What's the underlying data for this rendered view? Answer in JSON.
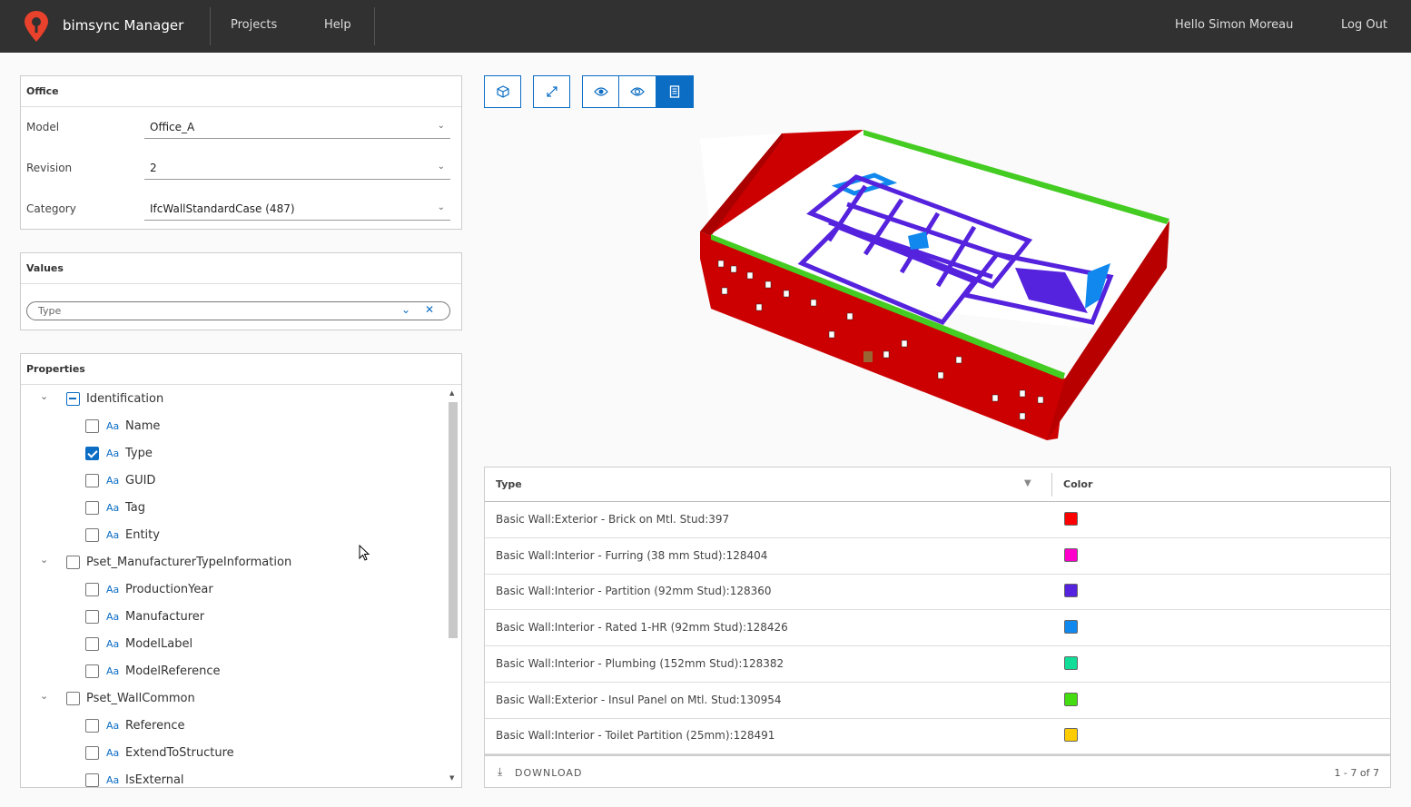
{
  "header": {
    "app_name": "bimsync Manager",
    "nav": [
      "Projects",
      "Help"
    ],
    "greeting": "Hello Simon Moreau",
    "logout": "Log Out"
  },
  "office_panel": {
    "title": "Office",
    "fields": [
      {
        "label": "Model",
        "value": "Office_A"
      },
      {
        "label": "Revision",
        "value": "2"
      },
      {
        "label": "Category",
        "value": "IfcWallStandardCase (487)"
      }
    ]
  },
  "values_panel": {
    "title": "Values",
    "selected": "Type"
  },
  "properties_panel": {
    "title": "Properties",
    "tree": [
      {
        "kind": "group",
        "label": "Identification",
        "state": "indeterminate"
      },
      {
        "kind": "item",
        "label": "Name",
        "checked": false
      },
      {
        "kind": "item",
        "label": "Type",
        "checked": true
      },
      {
        "kind": "item",
        "label": "GUID",
        "checked": false
      },
      {
        "kind": "item",
        "label": "Tag",
        "checked": false
      },
      {
        "kind": "item",
        "label": "Entity",
        "checked": false
      },
      {
        "kind": "group",
        "label": "Pset_ManufacturerTypeInformation",
        "state": "unchecked"
      },
      {
        "kind": "item",
        "label": "ProductionYear",
        "checked": false
      },
      {
        "kind": "item",
        "label": "Manufacturer",
        "checked": false
      },
      {
        "kind": "item",
        "label": "ModelLabel",
        "checked": false
      },
      {
        "kind": "item",
        "label": "ModelReference",
        "checked": false
      },
      {
        "kind": "group",
        "label": "Pset_WallCommon",
        "state": "unchecked"
      },
      {
        "kind": "item",
        "label": "Reference",
        "checked": false
      },
      {
        "kind": "item",
        "label": "ExtendToStructure",
        "checked": false
      },
      {
        "kind": "item",
        "label": "IsExternal",
        "checked": false
      }
    ],
    "type_icon_text": "Aa"
  },
  "toolbar": {
    "buttons": [
      {
        "name": "cube-view-button",
        "icon": "cube-icon"
      },
      {
        "name": "fullscreen-button",
        "icon": "expand-icon"
      },
      {
        "name": "show-button",
        "icon": "eye-filled-icon"
      },
      {
        "name": "hide-button",
        "icon": "eye-outline-icon"
      },
      {
        "name": "table-button",
        "icon": "document-icon",
        "active": true
      }
    ]
  },
  "grid": {
    "columns": [
      "Type",
      "Color"
    ],
    "rows": [
      {
        "type": "Basic Wall:Exterior - Brick on Mtl. Stud:397",
        "color": "#ff0000"
      },
      {
        "type": "Basic Wall:Interior - Furring (38 mm Stud):128404",
        "color": "#ff00cc"
      },
      {
        "type": "Basic Wall:Interior - Partition (92mm Stud):128360",
        "color": "#5522dd"
      },
      {
        "type": "Basic Wall:Interior - Rated 1-HR (92mm Stud):128426",
        "color": "#1188ee"
      },
      {
        "type": "Basic Wall:Interior - Plumbing (152mm Stud):128382",
        "color": "#11dd99"
      },
      {
        "type": "Basic Wall:Exterior - Insul Panel on Mtl. Stud:130954",
        "color": "#44dd11"
      },
      {
        "type": "Basic Wall:Interior - Toilet Partition (25mm):128491",
        "color": "#ffcc00"
      }
    ],
    "download_label": "DOWNLOAD",
    "pager": "1 - 7 of 7"
  }
}
